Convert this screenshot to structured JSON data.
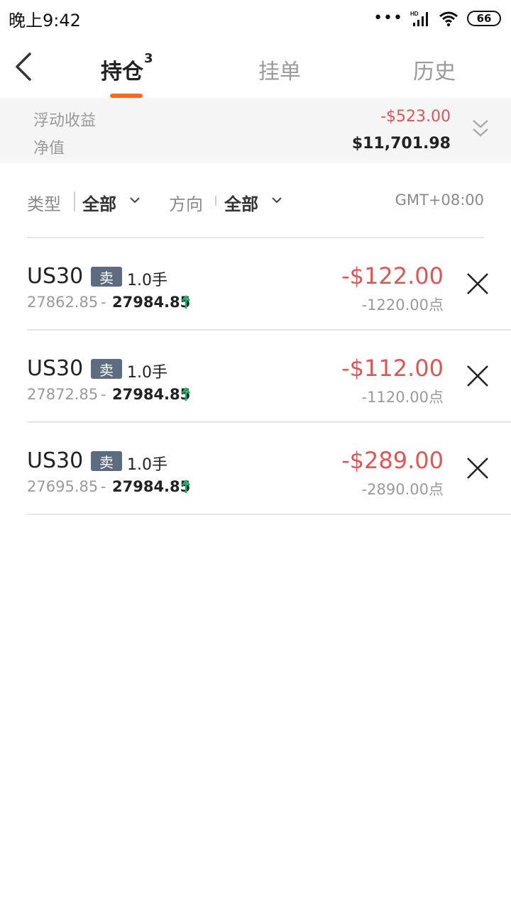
{
  "status_bar": {
    "time": "晚上9:42",
    "signal_label": "HD",
    "battery": "66",
    "more_dots": "•••"
  },
  "header": {
    "tabs": [
      {
        "label": "持仓",
        "badge": "3",
        "active": true
      },
      {
        "label": "挂单",
        "active": false
      },
      {
        "label": "历史",
        "active": false
      }
    ],
    "accent_color": "#f26d21"
  },
  "summary": {
    "floating_label": "浮动收益",
    "floating_value": "-$523.00",
    "equity_label": "净值",
    "equity_value": "$11,701.98"
  },
  "filters": {
    "type_label": "类型",
    "type_value": "全部",
    "direction_label": "方向",
    "direction_value": "全部",
    "timezone": "GMT+08:00"
  },
  "positions": [
    {
      "symbol": "US30",
      "side": "卖",
      "lots": "1.0手",
      "open_price": "27862.85",
      "separator": "-",
      "current_price": "27984.85",
      "pnl": "-$122.00",
      "points": "-1220.00点"
    },
    {
      "symbol": "US30",
      "side": "卖",
      "lots": "1.0手",
      "open_price": "27872.85",
      "separator": "-",
      "current_price": "27984.85",
      "pnl": "-$112.00",
      "points": "-1120.00点"
    },
    {
      "symbol": "US30",
      "side": "卖",
      "lots": "1.0手",
      "open_price": "27695.85",
      "separator": "-",
      "current_price": "27984.85",
      "pnl": "-$289.00",
      "points": "-2890.00点"
    }
  ],
  "colors": {
    "loss": "#e05555",
    "up_arrow": "#18b26b",
    "sell_badge": "#5c6b80"
  }
}
